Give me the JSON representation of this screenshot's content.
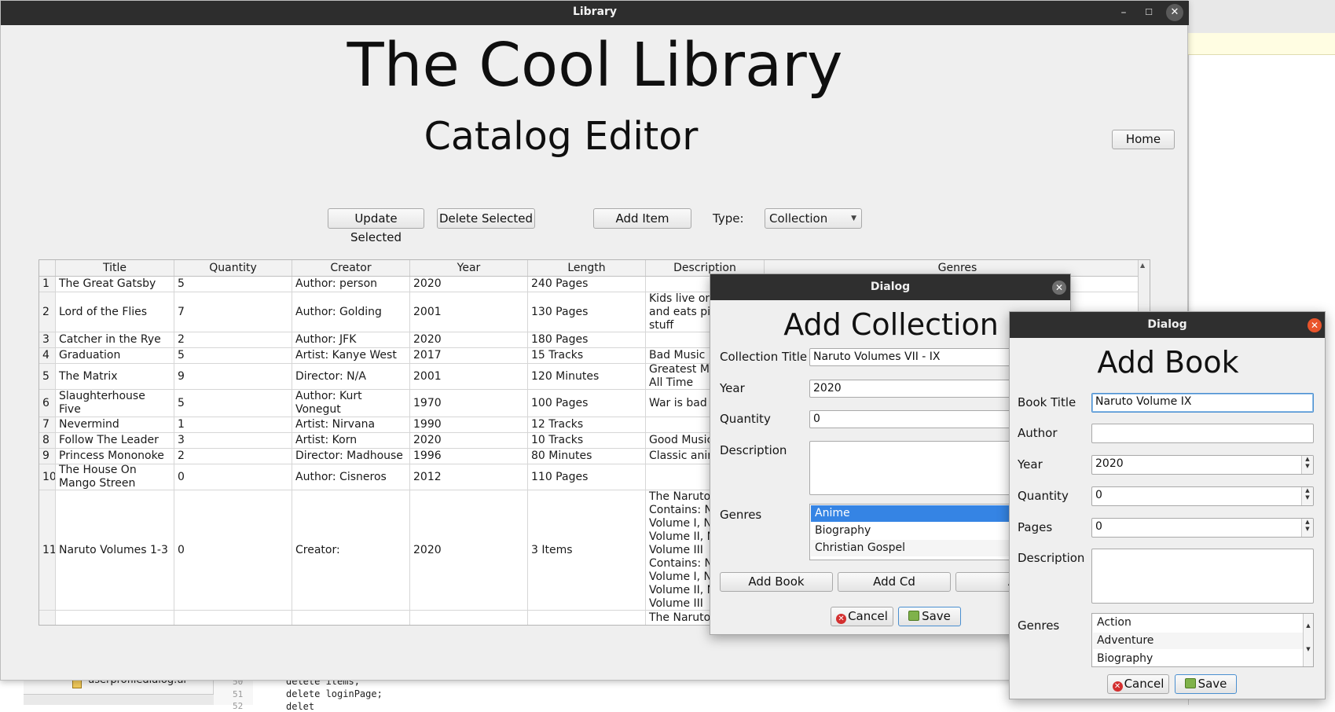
{
  "window": {
    "title": "Library"
  },
  "header": {
    "title": "The Cool Library",
    "subtitle": "Catalog Editor"
  },
  "toolbar": {
    "home_label": "Home",
    "update_label": "Update Selected",
    "delete_label": "Delete Selected",
    "add_label": "Add Item",
    "type_label": "Type:",
    "type_value": "Collection"
  },
  "table": {
    "columns": [
      "Title",
      "Quantity",
      "Creator",
      "Year",
      "Length",
      "Description",
      "Genres"
    ],
    "rows": [
      {
        "n": "1",
        "title": "The Great Gatsby",
        "quantity": "5",
        "creator": "Author: person",
        "year": "2020",
        "length": "240 Pages",
        "description": "",
        "genres": ""
      },
      {
        "n": "2",
        "title": "Lord of the Flies",
        "quantity": "7",
        "creator": "Author: Golding",
        "year": "2001",
        "length": "130 Pages",
        "description": "Kids live on an\nand eats pigs a\nstuff",
        "genres": ""
      },
      {
        "n": "3",
        "title": "Catcher in the Rye",
        "quantity": "2",
        "creator": "Author: JFK",
        "year": "2020",
        "length": "180 Pages",
        "description": "",
        "genres": ""
      },
      {
        "n": "4",
        "title": "Graduation",
        "quantity": "5",
        "creator": "Artist: Kanye West",
        "year": "2017",
        "length": "15 Tracks",
        "description": "Bad Music",
        "genres": ""
      },
      {
        "n": "5",
        "title": "The Matrix",
        "quantity": "9",
        "creator": "Director: N/A",
        "year": "2001",
        "length": "120 Minutes",
        "description": "Greatest Movie\nAll Time",
        "genres": ""
      },
      {
        "n": "6",
        "title": "Slaughterhouse Five",
        "quantity": "5",
        "creator": "Author: Kurt\nVonegut",
        "year": "1970",
        "length": "100 Pages",
        "description": "War is bad",
        "genres": ""
      },
      {
        "n": "7",
        "title": "Nevermind",
        "quantity": "1",
        "creator": "Artist: Nirvana",
        "year": "1990",
        "length": "12 Tracks",
        "description": "",
        "genres": ""
      },
      {
        "n": "8",
        "title": "Follow The Leader",
        "quantity": "3",
        "creator": "Artist: Korn",
        "year": "2020",
        "length": "10 Tracks",
        "description": "Good Music",
        "genres": ""
      },
      {
        "n": "9",
        "title": "Princess Mononoke",
        "quantity": "2",
        "creator": "Director: Madhouse",
        "year": "1996",
        "length": "80 Minutes",
        "description": "Classic anime f",
        "genres": ""
      },
      {
        "n": "10",
        "title": "The House On\nMango Streen",
        "quantity": "0",
        "creator": "Author: Cisneros",
        "year": "2012",
        "length": "110 Pages",
        "description": "",
        "genres": ""
      },
      {
        "n": "11",
        "title": "Naruto Volumes 1-3",
        "quantity": "0",
        "creator": "Creator:",
        "year": "2020",
        "length": "3 Items",
        "description": "The Naruto Ma\nContains: Naru\nVolume I, Naru\nVolume II, Naru\nVolume III\nContains: Naru\nVolume I, Naru\nVolume II, Naru\nVolume III",
        "genres": ""
      },
      {
        "n": "",
        "title": "",
        "quantity": "",
        "creator": "",
        "year": "",
        "length": "",
        "description": "The Naruto Ma",
        "genres": ""
      }
    ]
  },
  "collection_dialog": {
    "window_title": "Dialog",
    "heading": "Add Collection",
    "title_label": "Collection Title",
    "title_value": "Naruto Volumes VII - IX",
    "year_label": "Year",
    "year_value": "2020",
    "quantity_label": "Quantity",
    "quantity_value": "0",
    "description_label": "Description",
    "description_value": "",
    "genres_label": "Genres",
    "genres": [
      "Anime",
      "Biography",
      "Christian Gospel"
    ],
    "add_book_label": "Add Book",
    "add_cd_label": "Add Cd",
    "add_other_label": "A",
    "cancel_label": "Cancel",
    "save_label": "Save"
  },
  "book_dialog": {
    "window_title": "Dialog",
    "heading": "Add Book",
    "title_label": "Book Title",
    "title_value": "Naruto Volume IX",
    "author_label": "Author",
    "author_value": "",
    "year_label": "Year",
    "year_value": "2020",
    "quantity_label": "Quantity",
    "quantity_value": "0",
    "pages_label": "Pages",
    "pages_value": "0",
    "description_label": "Description",
    "description_value": "",
    "genres_label": "Genres",
    "genres": [
      "Action",
      "Adventure",
      "Biography"
    ],
    "cancel_label": "Cancel",
    "save_label": "Save"
  },
  "ide": {
    "file_name": "userprofiledialog.ui",
    "line_numbers": [
      "50",
      "51",
      "52"
    ],
    "code_lines": [
      "delete items;",
      "delete loginPage;",
      "delet"
    ]
  }
}
